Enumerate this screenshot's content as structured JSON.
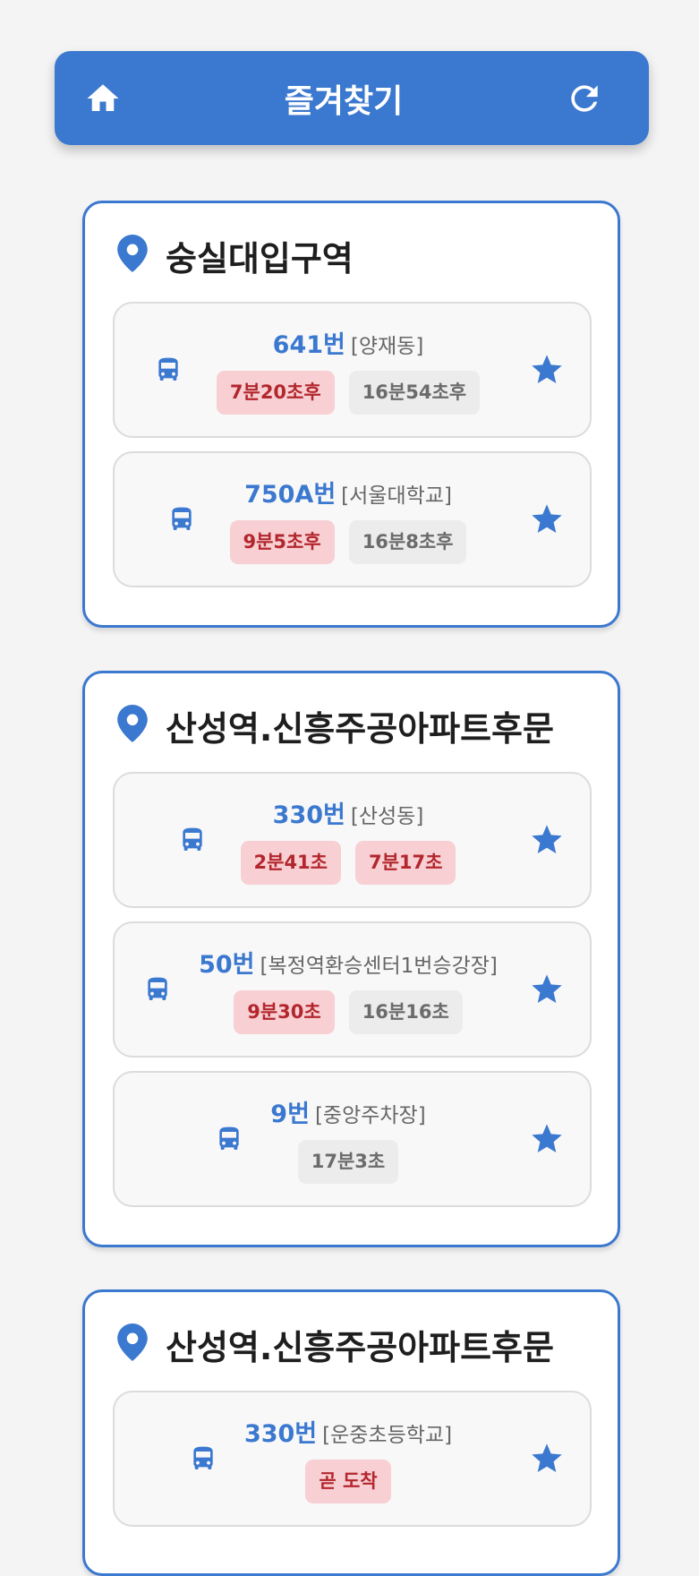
{
  "header": {
    "title": "즐겨찾기",
    "home_icon": "home-icon",
    "refresh_icon": "refresh-icon"
  },
  "stations": [
    {
      "name": "숭실대입구역",
      "buses": [
        {
          "number": "641번",
          "direction": "[양재동]",
          "arrivals": [
            {
              "text": "7분20초후",
              "style": "red"
            },
            {
              "text": "16분54초후",
              "style": "gray"
            }
          ]
        },
        {
          "number": "750A번",
          "direction": "[서울대학교]",
          "arrivals": [
            {
              "text": "9분5초후",
              "style": "red"
            },
            {
              "text": "16분8초후",
              "style": "gray"
            }
          ]
        }
      ]
    },
    {
      "name": "산성역.신흥주공아파트후문",
      "buses": [
        {
          "number": "330번",
          "direction": "[산성동]",
          "arrivals": [
            {
              "text": "2분41초",
              "style": "red"
            },
            {
              "text": "7분17초",
              "style": "red"
            }
          ]
        },
        {
          "number": "50번",
          "direction": "[복정역환승센터1번승강장]",
          "arrivals": [
            {
              "text": "9분30초",
              "style": "red"
            },
            {
              "text": "16분16초",
              "style": "gray"
            }
          ]
        },
        {
          "number": "9번",
          "direction": "[중앙주차장]",
          "arrivals": [
            {
              "text": "17분3초",
              "style": "gray"
            }
          ]
        }
      ]
    },
    {
      "name": "산성역.신흥주공아파트후문",
      "buses": [
        {
          "number": "330번",
          "direction": "[운중초등학교]",
          "arrivals": [
            {
              "text": "곧 도착",
              "style": "red"
            }
          ]
        }
      ]
    }
  ],
  "colors": {
    "accent": "#3b78cf",
    "urgent_bg": "#f8cfd3",
    "urgent_text": "#b2272d",
    "normal_bg": "#ececec",
    "normal_text": "#6b6b6b"
  }
}
